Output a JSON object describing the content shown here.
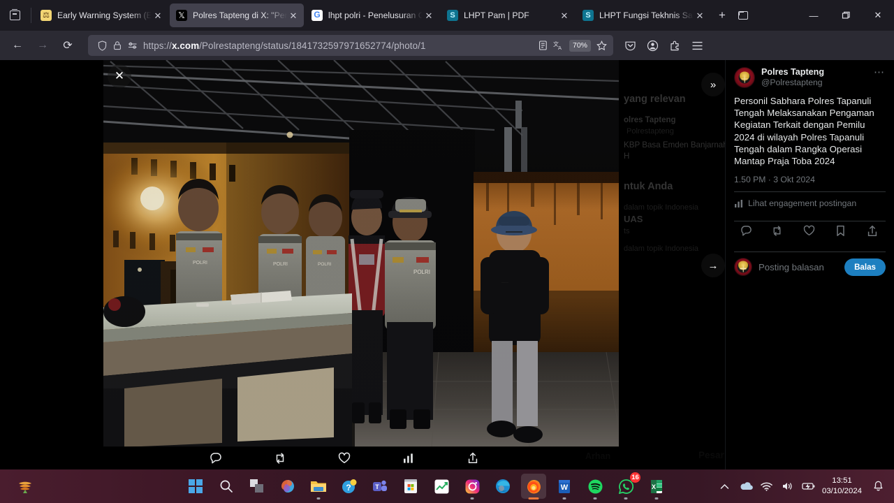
{
  "browser": {
    "tabs": [
      {
        "title": "Early Warning System (EW",
        "favicon": "scales-icon",
        "active": false
      },
      {
        "title": "Polres Tapteng di X: \"Perso",
        "favicon": "x-logo-icon",
        "active": true
      },
      {
        "title": "lhpt polri - Penelusuran Go",
        "favicon": "google-icon",
        "active": false
      },
      {
        "title": "LHPT Pam | PDF",
        "favicon": "scribd-icon",
        "active": false
      },
      {
        "title": "LHPT Fungsi Tekhnis Sabha",
        "favicon": "scribd-icon",
        "active": false
      }
    ],
    "new_tab_label": "+",
    "firefox_view_name": "firefox-view",
    "list_all_tabs_name": "list-all-tabs",
    "window_controls": {
      "minimize": "—",
      "maximize": "❐",
      "close": "✕"
    },
    "nav": {
      "back": "←",
      "forward": "→",
      "reload": "⟳"
    },
    "url": "https://x.com/Polrestapteng/status/1841732597971652774/photo/1",
    "url_domain": "x.com",
    "url_prefix": "https://",
    "url_suffix": "/Polrestapteng/status/1841732597971652774/photo/1",
    "zoom_level": "70%",
    "toolbar_icons": [
      "reader-view-icon",
      "translate-icon",
      "zoom-level-chip",
      "bookmark-star-icon"
    ],
    "right_icons": [
      "pocket-save-icon",
      "account-icon",
      "extensions-icon",
      "app-menu-icon"
    ],
    "identity_icons": [
      "shield-icon",
      "lock-icon",
      "permissions-icon"
    ]
  },
  "viewer": {
    "close_label": "✕",
    "expand_label": "»",
    "next_label": "→",
    "actions": [
      "reply-icon",
      "retweet-icon",
      "like-icon",
      "views-icon",
      "share-icon"
    ]
  },
  "sidebar": {
    "display_name": "Polres Tapteng",
    "handle": "@Polrestapteng",
    "more_label": "⋯",
    "tweet_text": "Personil Sabhara Polres Tapanuli Tengah Melaksanakan Pengaman Kegiatan Terkait dengan Pemilu 2024 di wilayah Polres Tapanuli Tengah dalam Rangka Operasi Mantap Praja Toba 2024",
    "timestamp": "1.50 PM · 3 Okt 2024",
    "engagement_label": "Lihat engagement postingan",
    "actions": [
      "reply-icon",
      "retweet-icon",
      "like-icon",
      "bookmark-icon",
      "share-icon"
    ],
    "reply_placeholder": "Posting balasan",
    "reply_button": "Balas"
  },
  "background_ghost": {
    "relevant_heading": "yang relevan",
    "account_name": "olres Tapteng",
    "account_handle": "Polrestapteng",
    "line_1": "KBP Basa Emden Banjarnahor, S",
    "line_2": "H",
    "for_you_heading": "ntuk Anda",
    "topic_1": "dalam topik Indonesia",
    "topic_2": "UAS",
    "topic_3": "ts",
    "topic_4": "dalam topik Indonesia",
    "trend_1": "Arhan",
    "trend_2": "Pesar"
  },
  "taskbar": {
    "items": [
      {
        "name": "start-button",
        "icon": "windows-logo-icon"
      },
      {
        "name": "search-button",
        "icon": "search-icon"
      },
      {
        "name": "task-view-button",
        "icon": "task-view-icon"
      },
      {
        "name": "copilot-button",
        "icon": "copilot-icon"
      },
      {
        "name": "file-explorer-button",
        "icon": "folder-icon"
      },
      {
        "name": "help-button",
        "icon": "question-mark-icon"
      },
      {
        "name": "teams-button",
        "icon": "teams-icon"
      },
      {
        "name": "microsoft-store-button",
        "icon": "store-icon"
      },
      {
        "name": "analytics-app-button",
        "icon": "chart-icon"
      },
      {
        "name": "instagram-button",
        "icon": "instagram-icon"
      },
      {
        "name": "edge-button",
        "icon": "edge-icon"
      },
      {
        "name": "firefox-button",
        "icon": "firefox-icon"
      },
      {
        "name": "word-button",
        "icon": "word-icon"
      },
      {
        "name": "spotify-button",
        "icon": "spotify-icon"
      },
      {
        "name": "whatsapp-button",
        "icon": "whatsapp-icon",
        "badge": "16"
      },
      {
        "name": "excel-button",
        "icon": "excel-icon"
      }
    ],
    "tray": [
      "show-hidden-icons",
      "onedrive-icon",
      "wifi-icon",
      "volume-icon",
      "battery-icon"
    ],
    "time": "13:51",
    "date": "03/10/2024",
    "notification_icon": "bell-icon"
  },
  "colors": {
    "accent_blue": "#1d7fc0",
    "chrome_bg": "#1c1b22",
    "nav_bg": "#2b2a33",
    "tab_active": "#42414d",
    "page_bg": "#000000",
    "muted_text": "#71767b"
  }
}
